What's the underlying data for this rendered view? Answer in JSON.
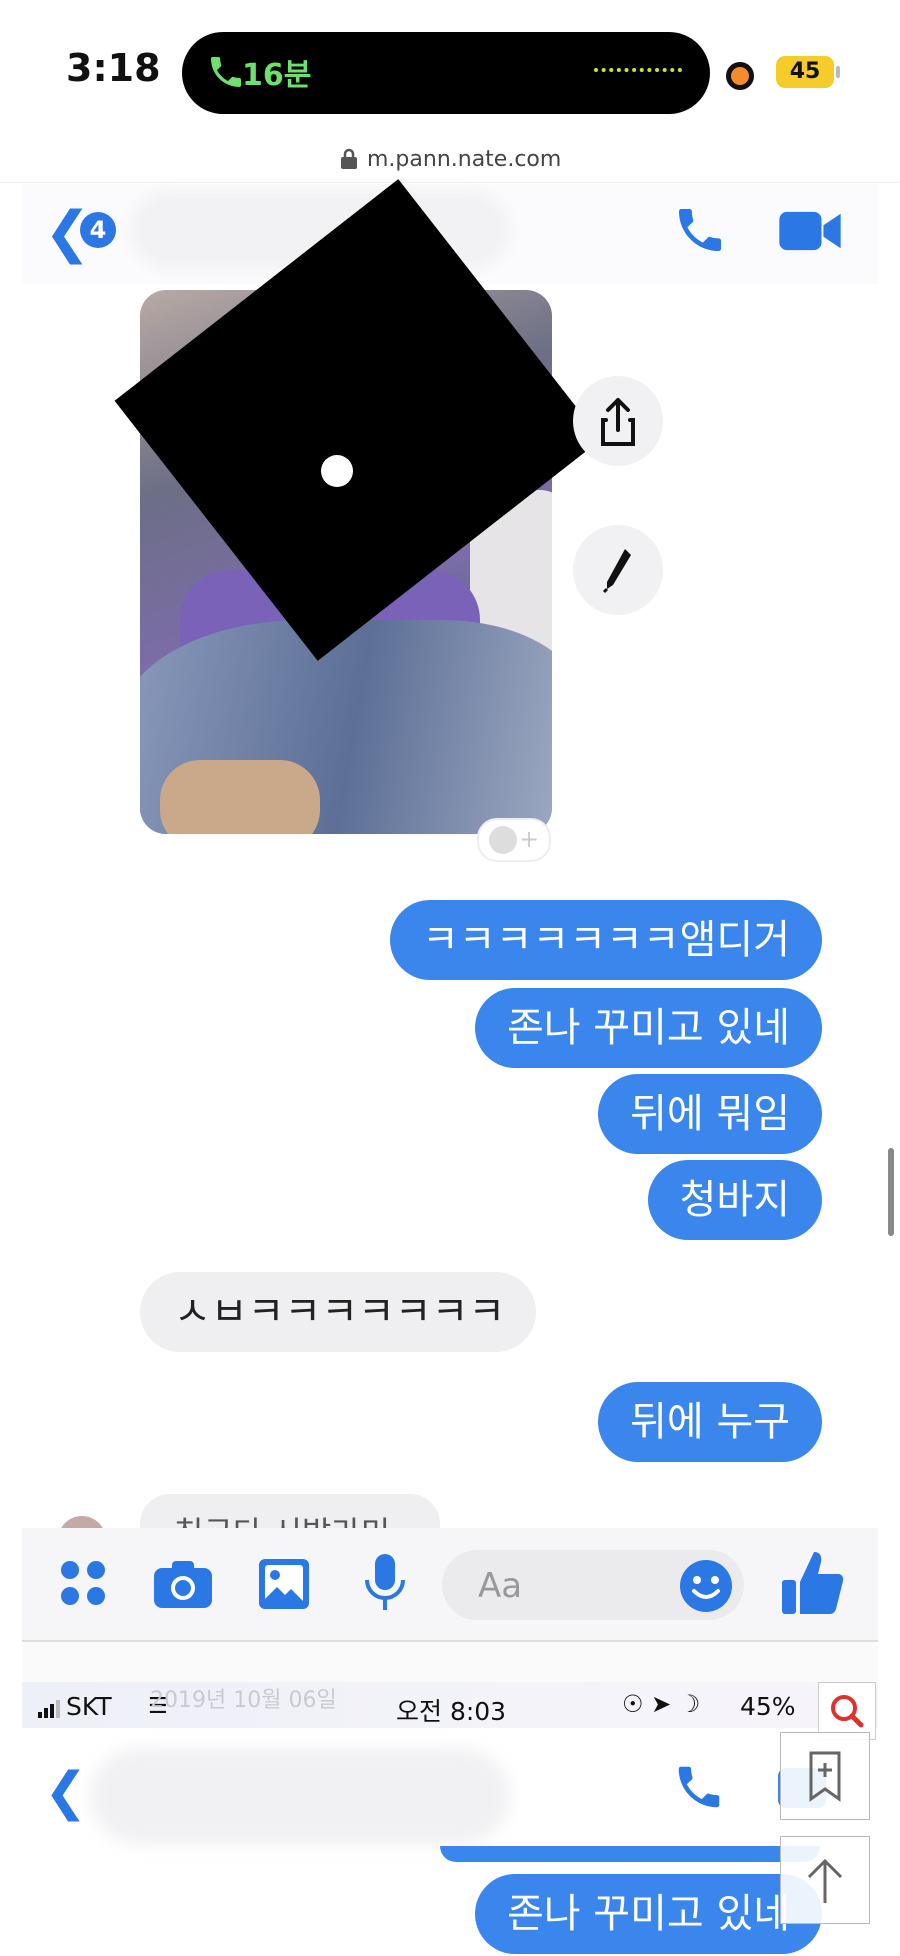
{
  "status_bar": {
    "time": "3:18",
    "call_duration": "16분",
    "battery": "45"
  },
  "browser": {
    "url": "m.pann.nate.com"
  },
  "chat_header": {
    "unread_count": "4"
  },
  "messages": {
    "m1": "ㅋㅋㅋㅋㅋㅋㅋ앰디거",
    "m2": "존나 꾸미고 있네",
    "m3": "뒤에 뭐임",
    "m4": "청바지",
    "t1": "ㅅㅂㅋㅋㅋㅋㅋㅋㅋ",
    "m5": "뒤에 누구",
    "partial": "친구다 시발라미"
  },
  "composer": {
    "placeholder": "Aa"
  },
  "screenshot2": {
    "carrier": "SKT",
    "time": "오전 8:03",
    "battery": "45%",
    "ghost_date": "2019년 10월 06일",
    "bubble": "존나 꾸미고 있네"
  },
  "colors": {
    "accent": "#3b86ec",
    "received_bubble": "#efeff1",
    "island": "#000000",
    "call_green": "#6ee06e"
  }
}
